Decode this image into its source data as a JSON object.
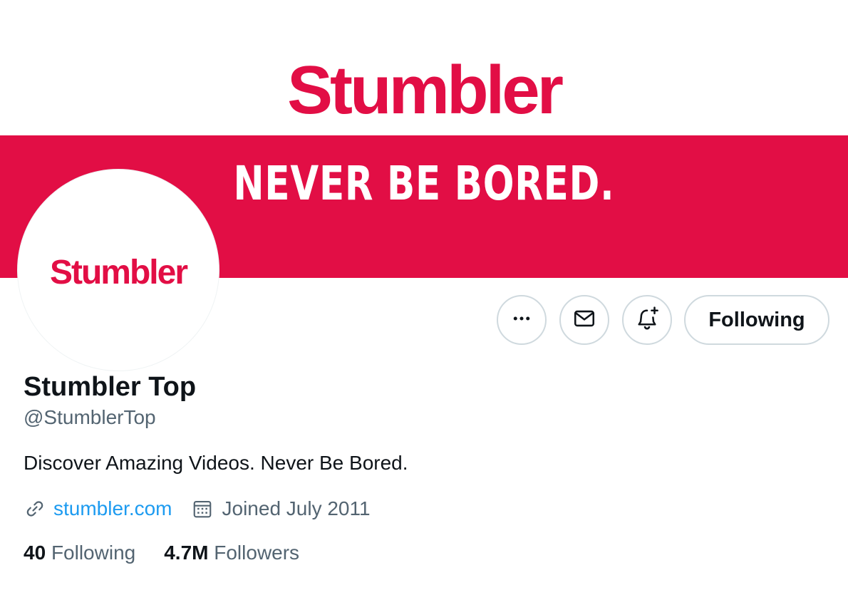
{
  "banner": {
    "logo_text": "Stumbler",
    "tagline": "NEVER BE BORED.",
    "accent_color": "#e20e45"
  },
  "avatar": {
    "logo_text": "Stumbler"
  },
  "actions": {
    "more_icon": "more-horizontal-icon",
    "message_icon": "mail-icon",
    "notify_icon": "bell-plus-icon",
    "follow_label": "Following"
  },
  "profile": {
    "name": "Stumbler Top",
    "handle": "@StumblerTop",
    "bio": "Discover Amazing Videos. Never Be Bored.",
    "website": "stumbler.com",
    "joined": "Joined July 2011"
  },
  "stats": {
    "following_count": "40",
    "following_label": "Following",
    "followers_count": "4.7M",
    "followers_label": "Followers"
  },
  "colors": {
    "link": "#1d9bf0",
    "secondary_text": "#536471",
    "border": "#cfd9de"
  }
}
